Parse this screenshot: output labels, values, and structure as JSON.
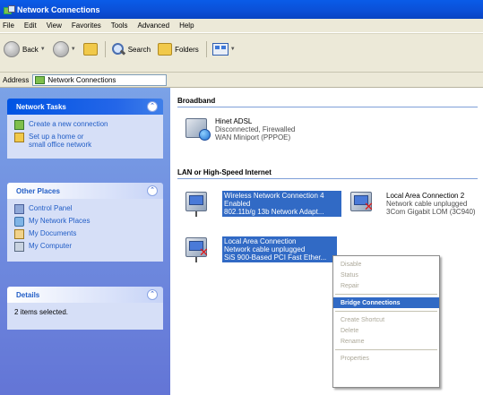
{
  "window": {
    "title": "Network Connections"
  },
  "menu": [
    "File",
    "Edit",
    "View",
    "Favorites",
    "Tools",
    "Advanced",
    "Help"
  ],
  "toolbar": {
    "back_label": "Back",
    "search_label": "Search",
    "folders_label": "Folders"
  },
  "address": {
    "label": "Address",
    "value": "Network Connections"
  },
  "sidebar": {
    "network_tasks": {
      "title": "Network Tasks",
      "items": [
        "Create a new connection",
        "Set up a home or small office network"
      ]
    },
    "other_places": {
      "title": "Other Places",
      "items": [
        "Control Panel",
        "My Network Places",
        "My Documents",
        "My Computer"
      ]
    },
    "details": {
      "title": "Details",
      "text": "2 items selected."
    }
  },
  "groups": {
    "broadband": "Broadband",
    "lan": "LAN or High-Speed Internet"
  },
  "connections": {
    "hinet": {
      "name": "Hinet ADSL",
      "status": "Disconnected, Firewalled",
      "device": "WAN Miniport (PPPOE)"
    },
    "wireless": {
      "name": "Wireless Network Connection 4",
      "status": "Enabled",
      "device": "802.11b/g 13b Network Adapt..."
    },
    "lac2": {
      "name": "Local Area Connection 2",
      "status": "Network cable unplugged",
      "device": "3Com Gigabit LOM (3C940)"
    },
    "lac": {
      "name": "Local Area Connection",
      "status": "Network cable unplugged",
      "device": "SiS 900-Based PCI Fast Ether..."
    }
  },
  "context_menu": {
    "items": [
      "Disable",
      "Status",
      "Repair",
      "Bridge Connections",
      "Create Shortcut",
      "Delete",
      "Rename",
      "Properties"
    ]
  },
  "icons": {
    "back": "back-arrow-icon",
    "forward": "forward-arrow-icon",
    "up": "folder-up-icon",
    "search": "search-icon",
    "folders": "folders-icon",
    "views": "views-icon"
  },
  "colors": {
    "title_blue": "#0b4fd6",
    "selection": "#316ac5",
    "sidebar_bg": "#6f8ee0",
    "link_blue": "#215dc6"
  }
}
